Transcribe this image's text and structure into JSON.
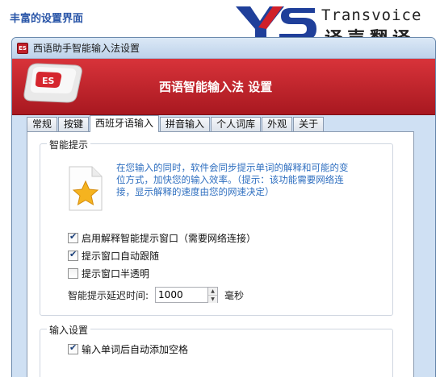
{
  "page_caption": "丰富的设置界面",
  "brand": {
    "name_en": "Transvoice",
    "name_cn": "译声翻译",
    "seal_letters": "YS"
  },
  "window": {
    "title": "西语助手智能输入法设置",
    "title_icon": "ES"
  },
  "banner": {
    "logo_key_label": "ES",
    "heading": "西语智能输入法 设置"
  },
  "tabs": [
    "常规",
    "按键",
    "西班牙语输入",
    "拼音输入",
    "个人词库",
    "外观",
    "关于"
  ],
  "active_tab_index": 2,
  "smart_hint": {
    "group_title": "智能提示",
    "description": "在您输入的同时，软件会同步提示单词的解释和可能的变位方式，加快您的输入效率。（提示：该功能需要网络连接，显示解释的速度由您的网速决定）",
    "options": [
      {
        "label": "启用解释智能提示窗口（需要网络连接）",
        "checked": true
      },
      {
        "label": "提示窗口自动跟随",
        "checked": true
      },
      {
        "label": "提示窗口半透明",
        "checked": false
      }
    ],
    "delay_label": "智能提示延迟时间:",
    "delay_value": "1000",
    "delay_unit": "毫秒"
  },
  "input_settings": {
    "group_title": "输入设置",
    "options": [
      {
        "label": "输入单词后自动添加空格",
        "checked": true
      }
    ]
  },
  "colors": {
    "banner_red": "#c5242c",
    "hint_blue": "#2f6fc0",
    "caption_blue": "#2a56a8",
    "brand_blue": "#1f3f9a",
    "brand_red": "#d0202a"
  }
}
